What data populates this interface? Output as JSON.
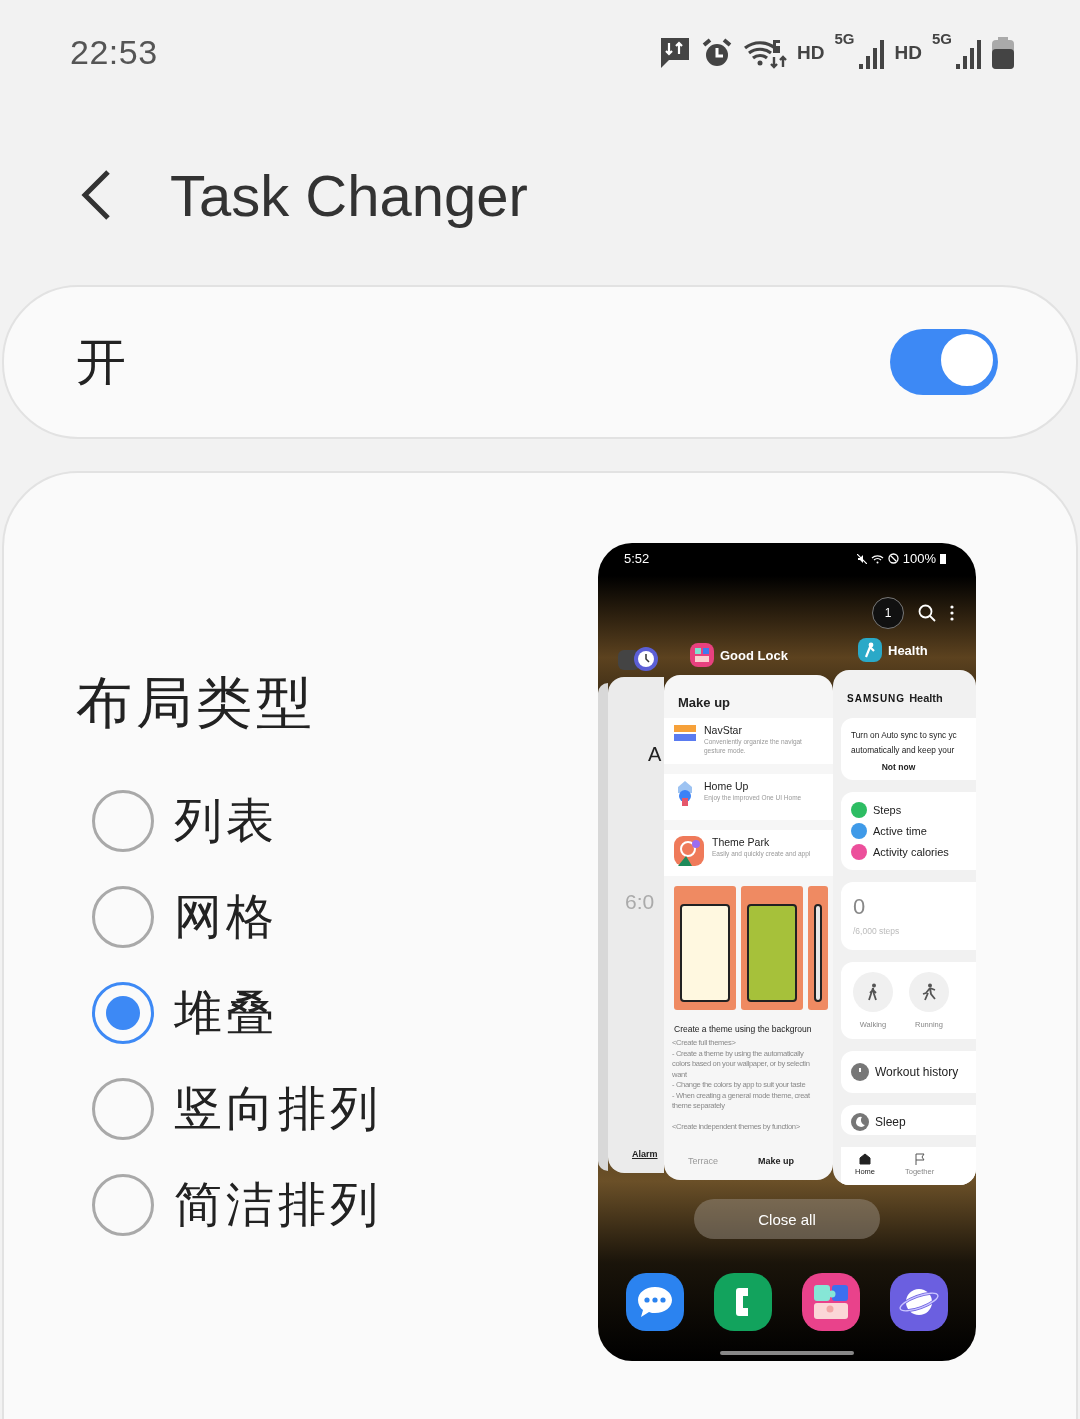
{
  "status_bar": {
    "time": "22:53",
    "labels": [
      "HD",
      "5G",
      "HD",
      "5G"
    ]
  },
  "header": {
    "title": "Task Changer"
  },
  "master_switch": {
    "label": "开",
    "on": true
  },
  "layout_type": {
    "title": "布局类型",
    "options": [
      {
        "label": "列表",
        "selected": false
      },
      {
        "label": "网格",
        "selected": false
      },
      {
        "label": "堆叠",
        "selected": true
      },
      {
        "label": "竖向排列",
        "selected": false
      },
      {
        "label": "简洁排列",
        "selected": false
      }
    ]
  },
  "preview": {
    "status_time": "5:52",
    "battery": "100%",
    "recent_count": "1",
    "app_labels": [
      "Good Lock",
      "Health"
    ],
    "back_card": {
      "letter": "A",
      "time": "6:0",
      "tab": {
        "label": "Alarm",
        "selected": true
      }
    },
    "goodlock_card": {
      "title": "Make up",
      "items": [
        {
          "name": "NavStar",
          "description": [
            "Conveniently organize the navigat",
            "gesture mode."
          ]
        },
        {
          "name": "Home Up",
          "description": [
            "Enjoy the improved One UI Home"
          ]
        },
        {
          "name": "Theme Park",
          "description": [
            "Easily and quickly create and appl"
          ]
        }
      ],
      "headline": "Create a theme using the backgroun",
      "lines": [
        "<Create full themes>",
        "- Create a theme by using the automatically",
        "colors based on your wallpaper, or by selectin",
        "want",
        "- Change the colors by app to suit your taste",
        "- When creating a general mode theme, creat",
        "theme separately",
        "<Create independent themes by function>"
      ],
      "tabs": [
        {
          "label": "Terrace",
          "selected": false
        },
        {
          "label": "Make up",
          "selected": true
        }
      ]
    },
    "health_card": {
      "logo": "SAMSUNG",
      "app": "Health",
      "sync_lines": [
        "Turn on Auto sync to sync yc",
        "automatically and keep your"
      ],
      "sync_button": "Not now",
      "metrics": [
        {
          "label": "Steps",
          "color": "#2dbd63"
        },
        {
          "label": "Active time",
          "color": "#3f9ae8"
        },
        {
          "label": "Activity calories",
          "color": "#ec4f9b"
        }
      ],
      "steps_count": "0",
      "steps_goal": "/6,000 steps",
      "activities": [
        "Walking",
        "Running"
      ],
      "workout": "Workout history",
      "sleep": "Sleep",
      "nav": [
        {
          "label": "Home",
          "selected": true
        },
        {
          "label": "Together",
          "selected": false
        }
      ]
    },
    "close_all": "Close all"
  }
}
